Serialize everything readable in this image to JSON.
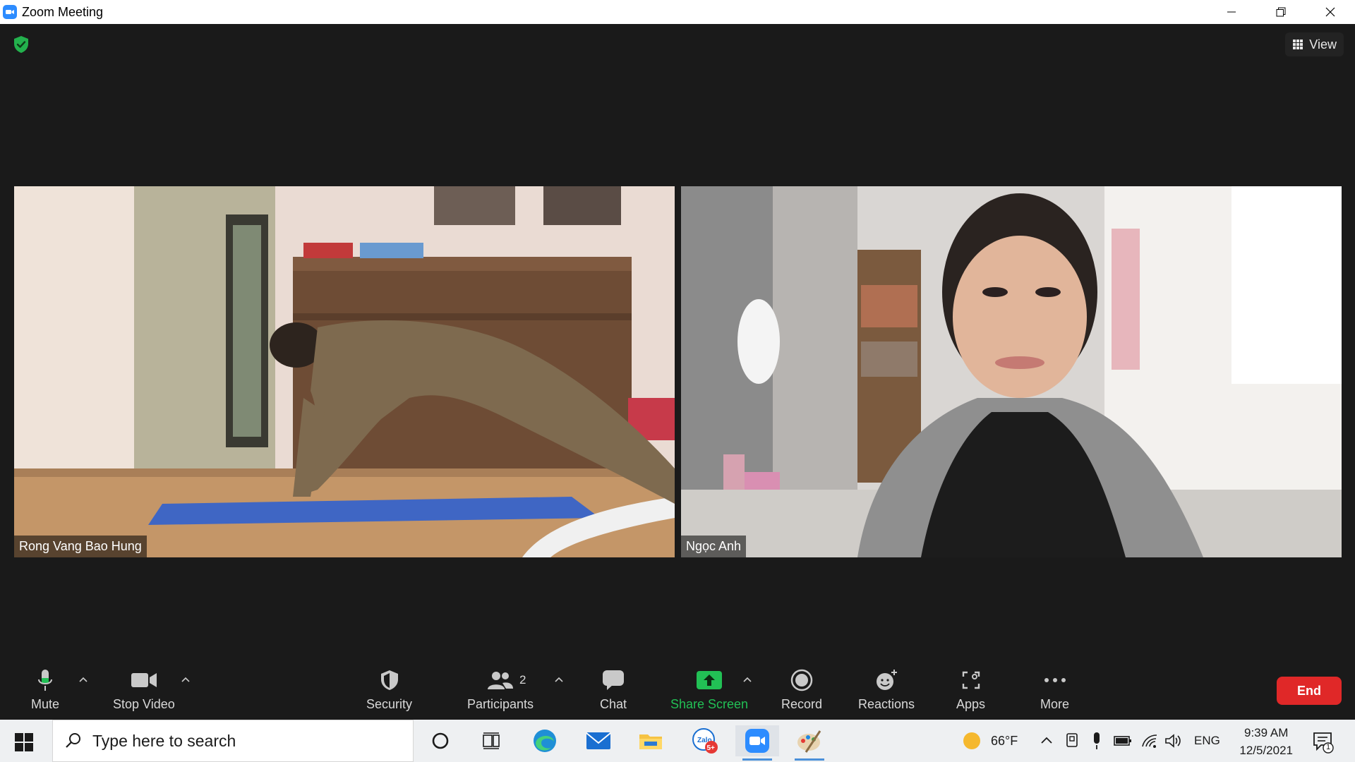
{
  "window": {
    "title": "Zoom Meeting"
  },
  "header": {
    "view_label": "View"
  },
  "participants": [
    {
      "name": "Rong Vang Bao Hung"
    },
    {
      "name": "Ngọc Anh"
    }
  ],
  "toolbar": {
    "mute_label": "Mute",
    "stop_video_label": "Stop Video",
    "security_label": "Security",
    "participants_label": "Participants",
    "participants_count": "2",
    "chat_label": "Chat",
    "share_screen_label": "Share Screen",
    "record_label": "Record",
    "reactions_label": "Reactions",
    "apps_label": "Apps",
    "more_label": "More",
    "end_label": "End"
  },
  "taskbar": {
    "search_placeholder": "Type here to search",
    "zalo_badge": "5+",
    "weather_temp": "66°F",
    "language": "ENG",
    "time": "9:39 AM",
    "date": "12/5/2021",
    "notification_count": "1"
  },
  "colors": {
    "accent_green": "#22c055",
    "end_red": "#e02828",
    "zoom_blue": "#2d8cff"
  }
}
